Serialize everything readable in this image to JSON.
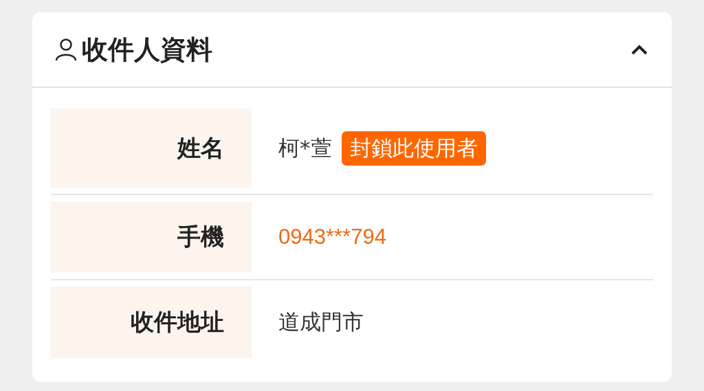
{
  "section": {
    "title": "收件人資料",
    "expanded": true
  },
  "rows": [
    {
      "label": "姓名",
      "value": "柯*萱",
      "kind": "text",
      "action": "封鎖此使用者"
    },
    {
      "label": "手機",
      "value": "0943***794",
      "kind": "phone"
    },
    {
      "label": "收件地址",
      "value": "道成門市",
      "kind": "text"
    }
  ]
}
